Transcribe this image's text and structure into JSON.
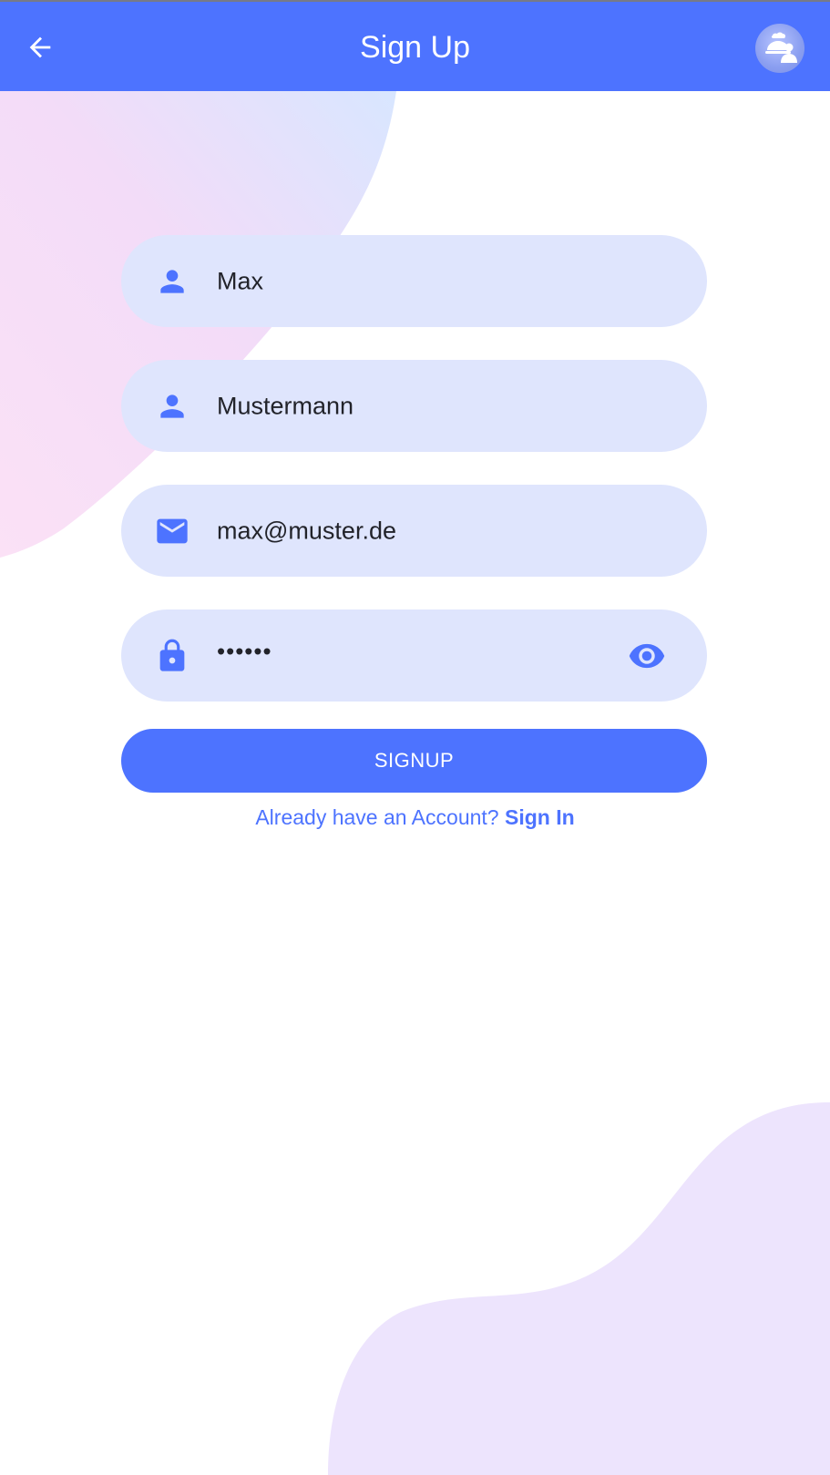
{
  "app_bar": {
    "title": "Sign Up",
    "back_icon": "arrow-back-icon",
    "avatar_icon": "chef-avatar-icon"
  },
  "form": {
    "first_name": {
      "value": "Max",
      "icon": "person-icon"
    },
    "last_name": {
      "value": "Mustermann",
      "icon": "person-icon"
    },
    "email": {
      "value": "max@muster.de",
      "icon": "mail-icon"
    },
    "password": {
      "value": "••••••",
      "icon": "lock-icon",
      "visibility_icon": "eye-icon"
    }
  },
  "signup_button": {
    "label": "SIGNUP"
  },
  "footer": {
    "prompt": "Already have an Account? ",
    "link": "Sign In"
  },
  "colors": {
    "primary": "#4d73ff",
    "field_background": "#dfe5fd",
    "text": "#22232a"
  }
}
